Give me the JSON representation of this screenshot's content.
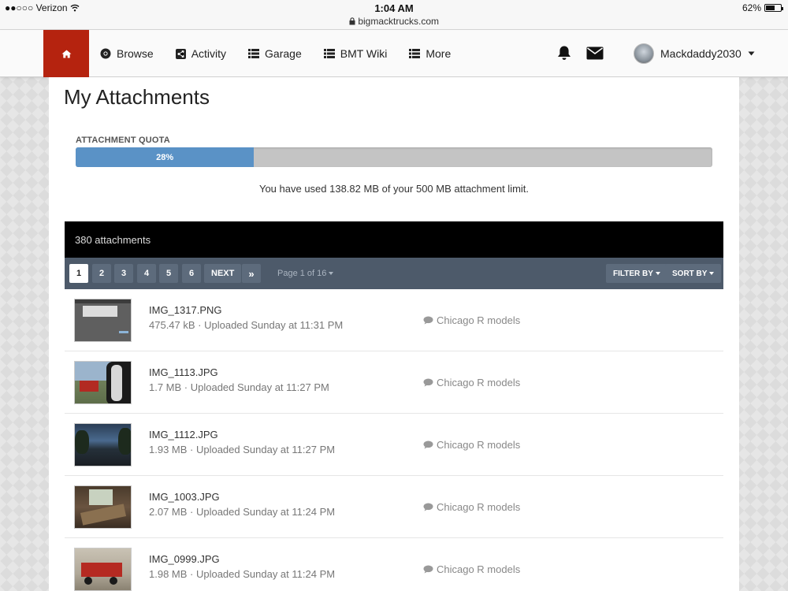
{
  "status_bar": {
    "carrier": "●●○○○ Verizon",
    "time": "1:04 AM",
    "url": "bigmacktrucks.com",
    "battery": "62%",
    "battery_level": 0.62
  },
  "nav": {
    "home_icon": "home-icon",
    "items": [
      {
        "label": "Browse",
        "icon": "compass-icon"
      },
      {
        "label": "Activity",
        "icon": "share-icon"
      },
      {
        "label": "Garage",
        "icon": "list-icon"
      },
      {
        "label": "BMT Wiki",
        "icon": "list-icon"
      },
      {
        "label": "More",
        "icon": "list-icon"
      }
    ],
    "username": "Mackdaddy2030",
    "accent_color": "#b5230f"
  },
  "page": {
    "title": "My Attachments"
  },
  "quota": {
    "label": "ATTACHMENT QUOTA",
    "percent_label": "28%",
    "percent": 28,
    "text": "You have used 138.82 MB of your 500 MB attachment limit."
  },
  "list": {
    "count_label": "380 attachments",
    "pages": [
      "1",
      "2",
      "3",
      "4",
      "5",
      "6"
    ],
    "next_label": "NEXT",
    "last_label": "»",
    "page_of": "Page 1 of 16",
    "filter_label": "FILTER BY",
    "sort_label": "SORT BY",
    "rows": [
      {
        "name": "IMG_1317.PNG",
        "meta": "475.47 kB · Uploaded Sunday at 11:31 PM",
        "topic": "Chicago R models"
      },
      {
        "name": "IMG_1113.JPG",
        "meta": "1.7 MB · Uploaded Sunday at 11:27 PM",
        "topic": "Chicago R models"
      },
      {
        "name": "IMG_1112.JPG",
        "meta": "1.93 MB · Uploaded Sunday at 11:27 PM",
        "topic": "Chicago R models"
      },
      {
        "name": "IMG_1003.JPG",
        "meta": "2.07 MB · Uploaded Sunday at 11:24 PM",
        "topic": "Chicago R models"
      },
      {
        "name": "IMG_0999.JPG",
        "meta": "1.98 MB · Uploaded Sunday at 11:24 PM",
        "topic": "Chicago R models"
      }
    ]
  }
}
